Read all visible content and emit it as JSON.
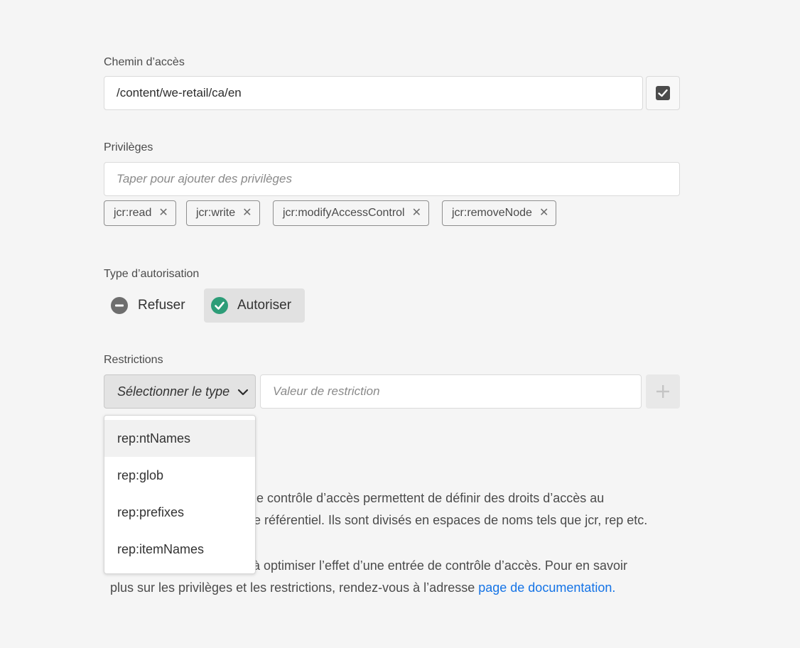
{
  "path": {
    "label": "Chemin d’accès",
    "value": "/content/we-retail/ca/en",
    "checkbox_checked": true
  },
  "privileges": {
    "label": "Privilèges",
    "placeholder": "Taper pour ajouter des privilèges",
    "tags": [
      "jcr:read",
      "jcr:write",
      "jcr:modifyAccessControl",
      "jcr:removeNode"
    ]
  },
  "permission_type": {
    "label": "Type d’autorisation",
    "deny_label": "Refuser",
    "allow_label": "Autoriser",
    "selected": "allow"
  },
  "restrictions": {
    "label": "Restrictions",
    "select_placeholder": "Sélectionner le type",
    "value_placeholder": "Valeur de restriction",
    "options": [
      "rep:ntNames",
      "rep:glob",
      "rep:prefixes",
      "rep:itemNames"
    ]
  },
  "description": {
    "line1": "ée de contrôle d’accès permettent de définir des droits d’accès au",
    "line2": "s le référentiel. Ils sont divisés en espaces de noms tels que jcr, rep etc.",
    "line3": "ent à optimiser l’effet d’une entrée de contrôle d’accès. Pour en savoir",
    "line4_text": "plus sur les privilèges et les restrictions, rendez-vous à l’adresse ",
    "link_text": "page de documentation."
  },
  "colors": {
    "allow_icon": "#2d9d78",
    "deny_icon": "#6e6e6e",
    "link": "#1473e6"
  }
}
